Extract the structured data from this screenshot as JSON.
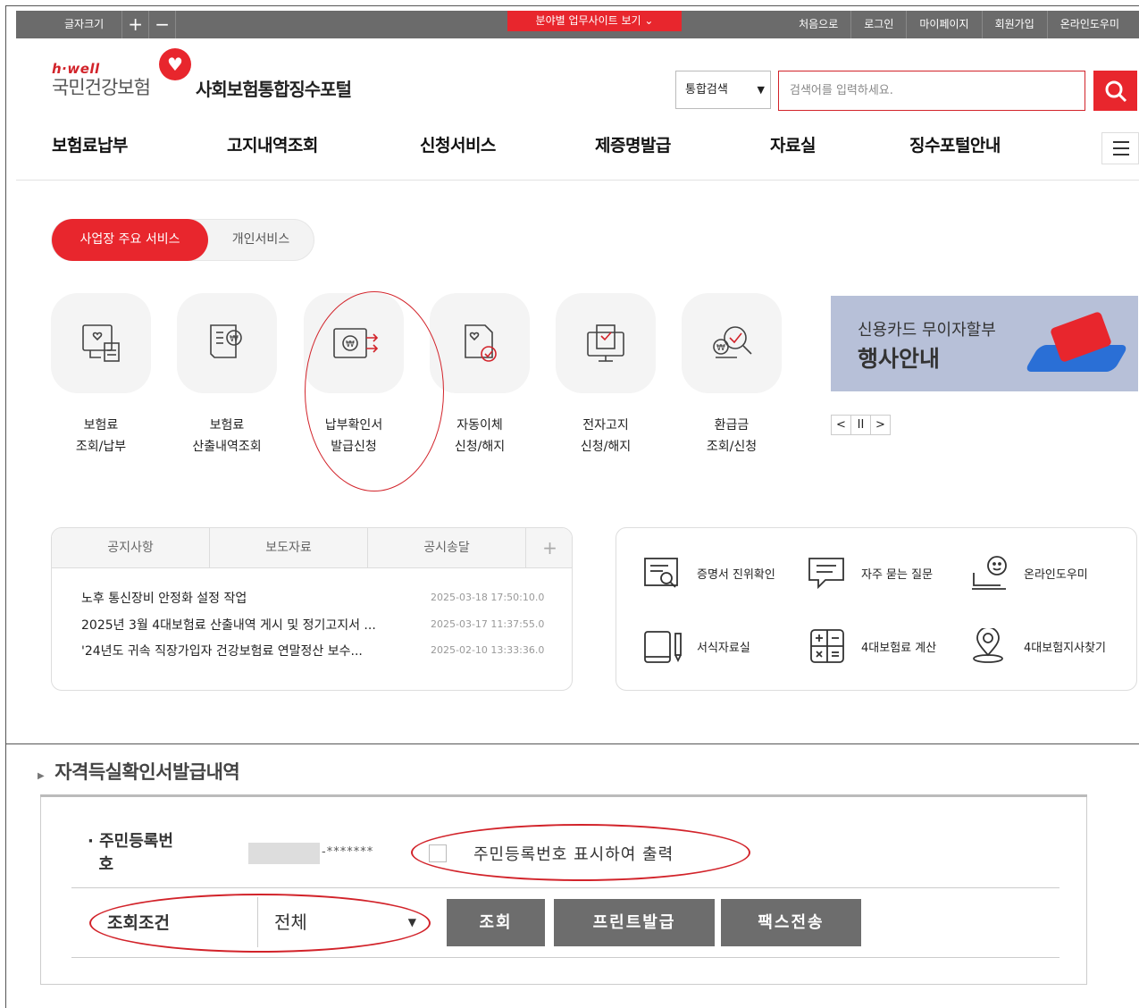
{
  "topbar": {
    "font_size_label": "글자크기",
    "increase": "+",
    "decrease": "−",
    "site_menu": "분야별 업무사이트 보기 ⌄",
    "links": [
      "처음으로",
      "로그인",
      "마이페이지",
      "회원가입",
      "온라인도우미"
    ]
  },
  "header": {
    "logo_small": "h·well",
    "logo_main": "국민건강보험",
    "portal_title": "사회보험통합징수포털",
    "search_scope": "통합검색",
    "search_placeholder": "검색어를 입력하세요."
  },
  "gnb": [
    "보험료납부",
    "고지내역조회",
    "신청서비스",
    "제증명발급",
    "자료실",
    "징수포털안내"
  ],
  "service_tabs": {
    "active": "사업장 주요 서비스",
    "inactive": "개인서비스"
  },
  "services": [
    {
      "line1": "보험료",
      "line2": "조회/납부",
      "icon": "bill-heart-icon"
    },
    {
      "line1": "보험료",
      "line2": "산출내역조회",
      "icon": "document-won-icon"
    },
    {
      "line1": "납부확인서",
      "line2": "발급신청",
      "icon": "won-transfer-icon"
    },
    {
      "line1": "자동이체",
      "line2": "신청/해지",
      "icon": "document-check-icon"
    },
    {
      "line1": "전자고지",
      "line2": "신청/해지",
      "icon": "monitor-check-icon"
    },
    {
      "line1": "환급금",
      "line2": "조회/신청",
      "icon": "search-check-icon"
    }
  ],
  "banner": {
    "line1": "신용카드 무이자할부",
    "line2": "행사안내",
    "controls": [
      "<",
      "II",
      ">"
    ]
  },
  "notice": {
    "tabs": [
      "공지사항",
      "보도자료",
      "공시송달"
    ],
    "more": "+",
    "items": [
      {
        "title": "노후 통신장비 안정화 설정 작업",
        "date": "2025-03-18 17:50:10.0"
      },
      {
        "title": "2025년 3월 4대보험료 산출내역 게시 및 정기고지서 ...",
        "date": "2025-03-17 11:37:55.0"
      },
      {
        "title": "'24년도 귀속 직장가입자 건강보험료 연말정산 보수...",
        "date": "2025-02-10 13:33:36.0"
      }
    ]
  },
  "quick_links": [
    {
      "label": "증명서 진위확인",
      "icon": "certificate-search-icon"
    },
    {
      "label": "자주 묻는 질문",
      "icon": "chat-icon"
    },
    {
      "label": "온라인도우미",
      "icon": "helper-laptop-icon"
    },
    {
      "label": "서식자료실",
      "icon": "book-pen-icon"
    },
    {
      "label": "4대보험료 계산",
      "icon": "calculator-icon"
    },
    {
      "label": "4대보험지사찾기",
      "icon": "location-pin-icon"
    }
  ],
  "section2": {
    "title": "자격득실확인서발급내역",
    "rrn_label_1": "주민등록번",
    "rrn_label_2": "호",
    "rrn_masked": "-*******",
    "show_rrn_label": "주민등록번호 표시하여 출력",
    "condition_label": "조회조건",
    "condition_value": "전체",
    "buttons": [
      "조회",
      "프린트발급",
      "팩스전송"
    ]
  },
  "colors": {
    "accent": "#e8262d",
    "topbar": "#6b6b6b",
    "banner": "#b7c0d8",
    "button": "#6d6d6d"
  }
}
